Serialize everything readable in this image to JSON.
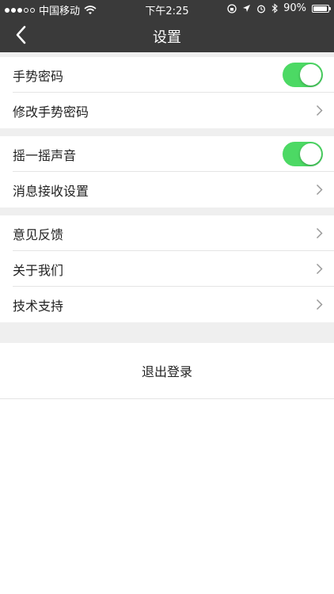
{
  "status_bar": {
    "carrier": "中国移动",
    "time": "下午2:25",
    "battery": "90%",
    "battery_level": 0.9
  },
  "nav": {
    "title": "设置"
  },
  "sections": {
    "gesture": {
      "gesture_password": {
        "label": "手势密码",
        "toggle": true
      },
      "change_gesture_password": {
        "label": "修改手势密码"
      }
    },
    "notify": {
      "shake_sound": {
        "label": "摇一摇声音",
        "toggle": true
      },
      "message_settings": {
        "label": "消息接收设置"
      }
    },
    "about": {
      "feedback": {
        "label": "意见反馈"
      },
      "about_us": {
        "label": "关于我们"
      },
      "tech_support": {
        "label": "技术支持"
      }
    }
  },
  "logout_label": "退出登录",
  "colors": {
    "bar": "#3a3a3a",
    "toggle_on": "#4cd964",
    "section_gap": "#efefef"
  }
}
